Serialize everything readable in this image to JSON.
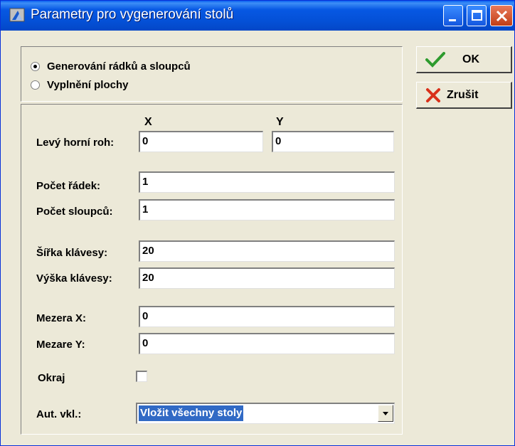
{
  "window": {
    "title": "Parametry pro vygenerování stolů",
    "icon": "app-icon",
    "controls": [
      "minimize-icon",
      "maximize-icon",
      "close-icon"
    ]
  },
  "mode": {
    "options": [
      {
        "label": "Generování rádků a sloupců",
        "checked": true
      },
      {
        "label": "Vyplnění plochy",
        "checked": false
      }
    ]
  },
  "form": {
    "axis_x": "X",
    "axis_y": "Y",
    "top_left_label": "Levý horní roh:",
    "top_left_x": "0",
    "top_left_y": "0",
    "rows_label": "Počet řádek:",
    "rows_value": "1",
    "cols_label": "Počet sloupců:",
    "cols_value": "1",
    "key_width_label": "Šířka klávesy:",
    "key_width_value": "20",
    "key_height_label": "Výška klávesy:",
    "key_height_value": "20",
    "gap_x_label": "Mezera X:",
    "gap_x_value": "0",
    "gap_y_label": "Mezare Y:",
    "gap_y_value": "0",
    "border_label": "Okraj",
    "border_checked": false,
    "auto_insert_label": "Aut. vkl.:",
    "auto_insert_value": "Vložit všechny stoly"
  },
  "buttons": {
    "ok": "OK",
    "cancel": "Zrušit"
  },
  "colors": {
    "titlebar": "#0450d6",
    "dialog_bg": "#ece9d8",
    "selection": "#316ac5",
    "ok_check": "#2e9b2e",
    "cancel_x": "#d9301a"
  }
}
